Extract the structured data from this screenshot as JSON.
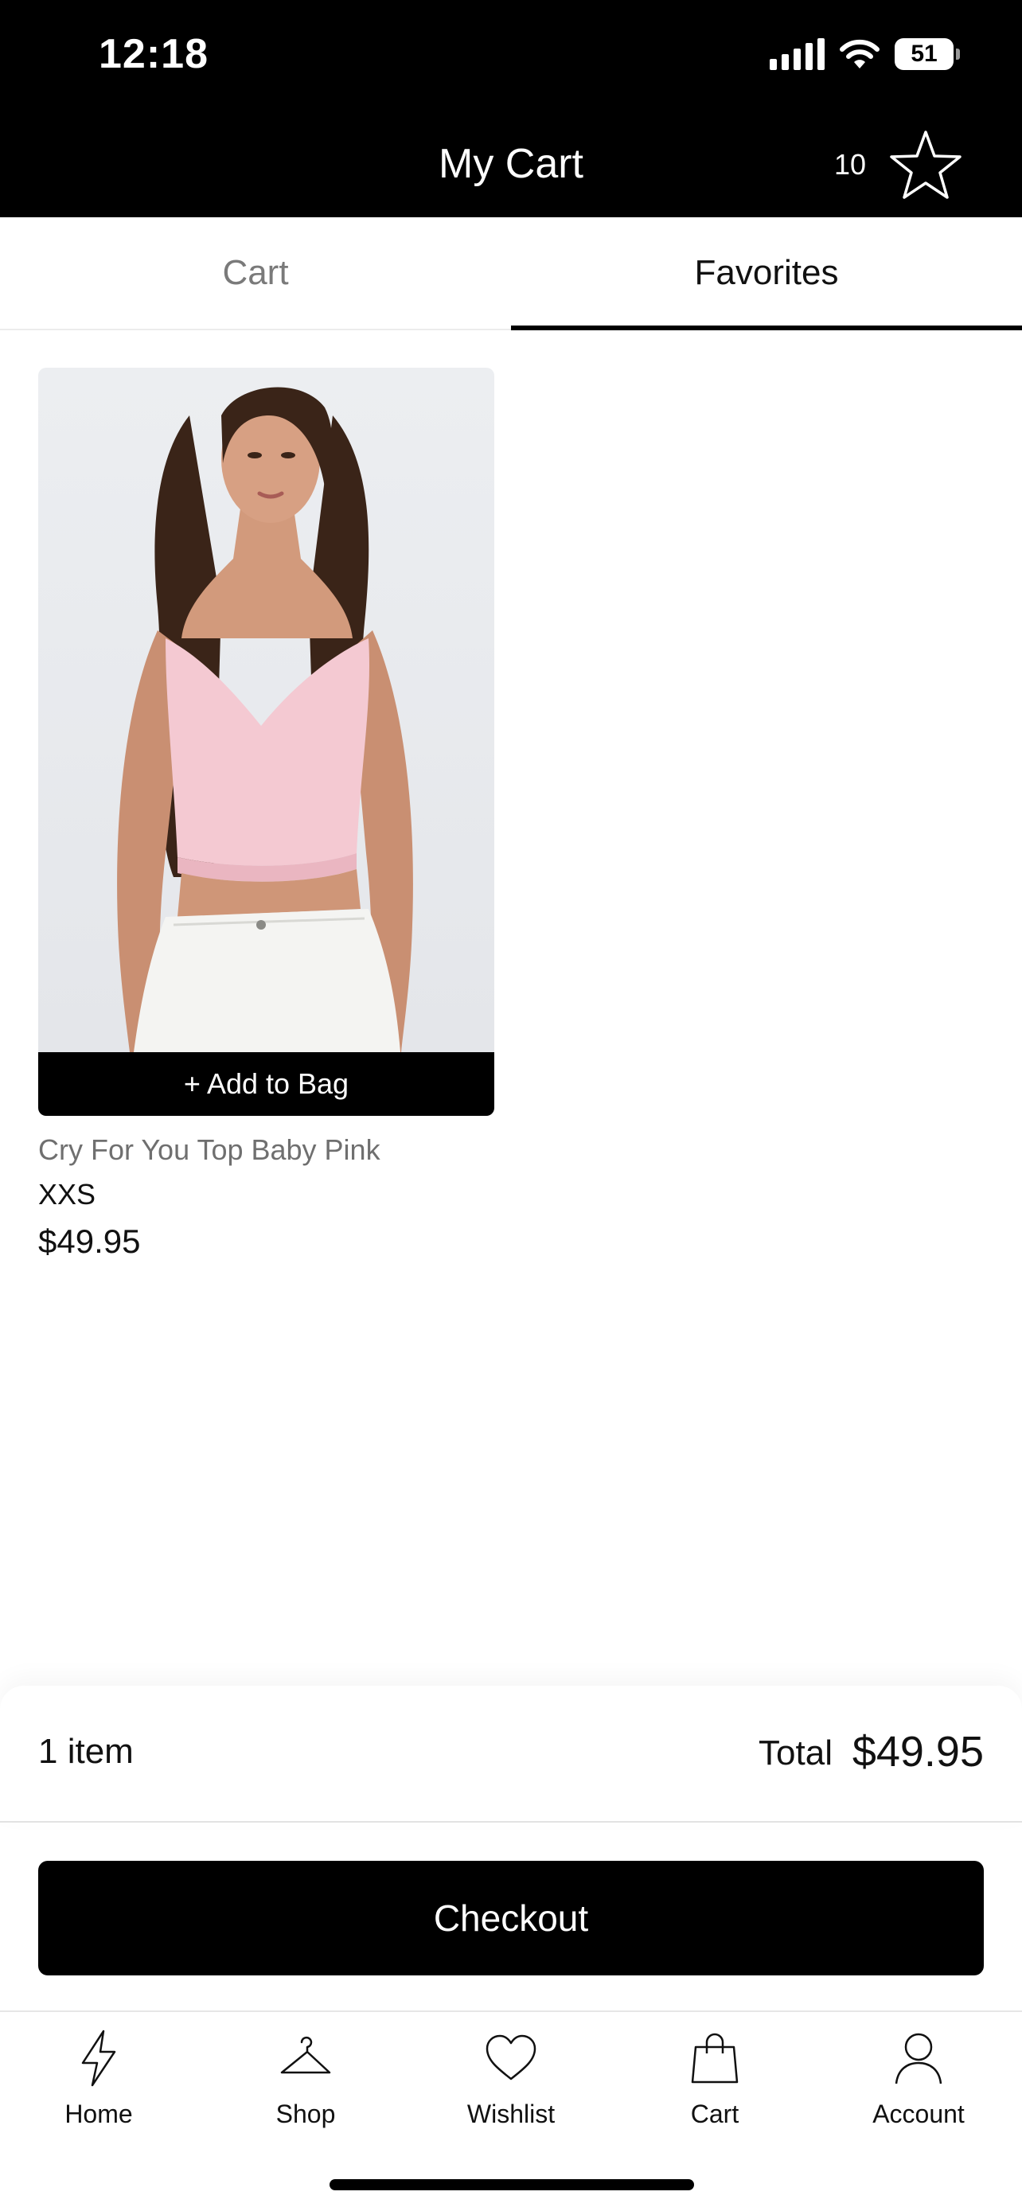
{
  "status_bar": {
    "time": "12:18",
    "battery": "51"
  },
  "header": {
    "title": "My Cart",
    "favorites_count": "10",
    "icon": "star-icon"
  },
  "tabs": [
    {
      "label": "Cart",
      "active": false
    },
    {
      "label": "Favorites",
      "active": true
    }
  ],
  "product": {
    "add_label": "+ Add to Bag",
    "name": "Cry For You Top Baby Pink",
    "size": "XXS",
    "price": "$49.95"
  },
  "summary": {
    "item_count": "1 item",
    "total_label": "Total",
    "total_value": "$49.95"
  },
  "checkout_label": "Checkout",
  "bottom_nav": [
    {
      "label": "Home",
      "icon": "lightning-icon"
    },
    {
      "label": "Shop",
      "icon": "hanger-icon"
    },
    {
      "label": "Wishlist",
      "icon": "heart-icon"
    },
    {
      "label": "Cart",
      "icon": "bag-icon"
    },
    {
      "label": "Account",
      "icon": "user-icon"
    }
  ],
  "colors": {
    "header_bg": "#000000",
    "product_top": "#f4c9d2",
    "accent": "#000000"
  }
}
